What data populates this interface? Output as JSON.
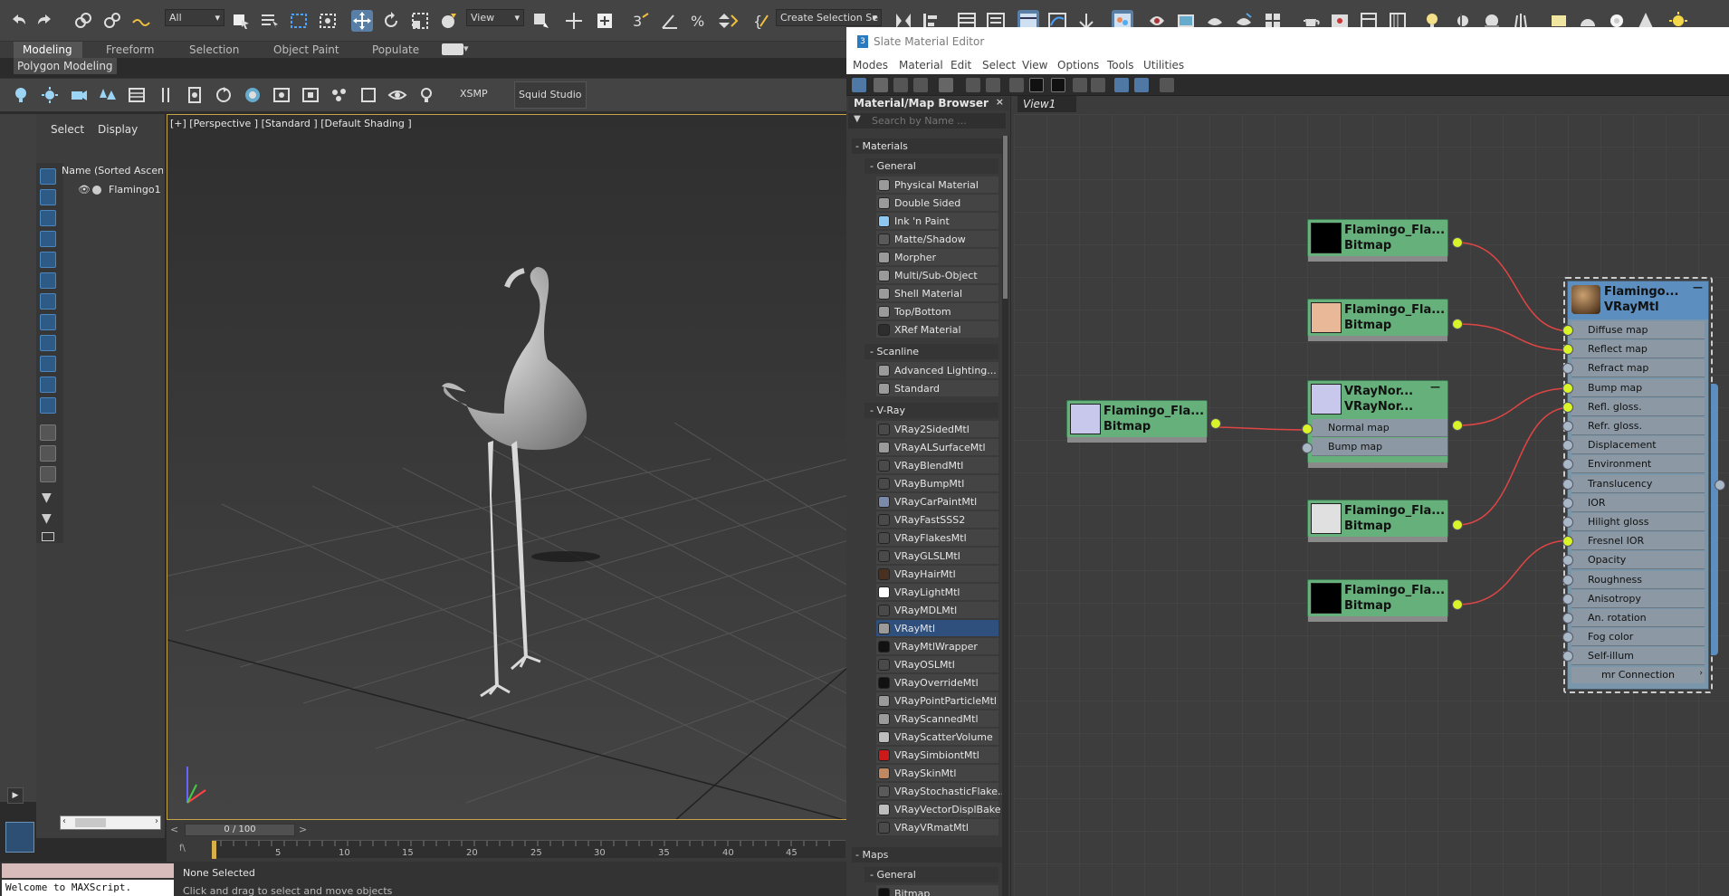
{
  "toolbar": {
    "selection_filter": "All",
    "ref_coord": "View",
    "named_selection": "Create Selection Se"
  },
  "ribbon": {
    "tabs": [
      "Modeling",
      "Freeform",
      "Selection",
      "Object Paint",
      "Populate"
    ],
    "active_panel": "Polygon Modeling",
    "xsmp_label": "XSMP",
    "plugin_label": "Squid Studio v"
  },
  "scene_explorer": {
    "tabs": [
      "Select",
      "Display"
    ],
    "column_header": "Name (Sorted Ascendi",
    "items": [
      "Flamingo1"
    ]
  },
  "viewport": {
    "label": "[+] [Perspective ] [Standard ] [Default Shading ]"
  },
  "timeline": {
    "frame_counter": "0 / 100",
    "ticks": [
      "5",
      "10",
      "15",
      "20",
      "25",
      "30",
      "35",
      "40",
      "45"
    ]
  },
  "status": {
    "maxscript": "Welcome to MAXScript.",
    "selection": "None Selected",
    "prompt": "Click and drag to select and move objects"
  },
  "slate": {
    "title": "Slate Material Editor",
    "menu": [
      "Modes",
      "Material",
      "Edit",
      "Select",
      "View",
      "Options",
      "Tools",
      "Utilities"
    ],
    "view_tab": "View1",
    "browser": {
      "title": "Material/Map Browser",
      "search_placeholder": "Search by Name ...",
      "materials_label": "- Materials",
      "groups": [
        {
          "label": "- General",
          "items": [
            {
              "name": "Physical Material",
              "swatch": "#9a9a9a"
            },
            {
              "name": "Double Sided",
              "swatch": "#9a9a9a"
            },
            {
              "name": "Ink 'n Paint",
              "swatch": "#8ec8f0"
            },
            {
              "name": "Matte/Shadow",
              "swatch": "#5a5a5a"
            },
            {
              "name": "Morpher",
              "swatch": "#9a9a9a"
            },
            {
              "name": "Multi/Sub-Object",
              "swatch": "#9a9a9a"
            },
            {
              "name": "Shell Material",
              "swatch": "#9a9a9a"
            },
            {
              "name": "Top/Bottom",
              "swatch": "#9a9a9a"
            },
            {
              "name": "XRef Material",
              "swatch": "#2e2e2e"
            }
          ]
        },
        {
          "label": "- Scanline",
          "items": [
            {
              "name": "Advanced Lighting...",
              "swatch": "#9a9a9a"
            },
            {
              "name": "Standard",
              "swatch": "#9a9a9a"
            }
          ]
        },
        {
          "label": "- V-Ray",
          "items": [
            {
              "name": "VRay2SidedMtl",
              "swatch": "#4a4a4a"
            },
            {
              "name": "VRayALSurfaceMtl",
              "swatch": "#9a9a9a"
            },
            {
              "name": "VRayBlendMtl",
              "swatch": "#4a4a4a"
            },
            {
              "name": "VRayBumpMtl",
              "swatch": "#4a4a4a"
            },
            {
              "name": "VRayCarPaintMtl",
              "swatch": "#7a8aa8"
            },
            {
              "name": "VRayFastSSS2",
              "swatch": "#4a4a4a"
            },
            {
              "name": "VRayFlakesMtl",
              "swatch": "#4a4a4a"
            },
            {
              "name": "VRayGLSLMtl",
              "swatch": "#4a4a4a"
            },
            {
              "name": "VRayHairMtl",
              "swatch": "#4a3020"
            },
            {
              "name": "VRayLightMtl",
              "swatch": "#ffffff"
            },
            {
              "name": "VRayMDLMtl",
              "swatch": "#4a4a4a"
            },
            {
              "name": "VRayMtl",
              "swatch": "#9a9a9a"
            },
            {
              "name": "VRayMtlWrapper",
              "swatch": "#111111"
            },
            {
              "name": "VRayOSLMtl",
              "swatch": "#4a4a4a"
            },
            {
              "name": "VRayOverrideMtl",
              "swatch": "#111111"
            },
            {
              "name": "VRayPointParticleMtl",
              "swatch": "#9a9a9a"
            },
            {
              "name": "VRayScannedMtl",
              "swatch": "#9a9a9a"
            },
            {
              "name": "VRayScatterVolume",
              "swatch": "#bdbdbd"
            },
            {
              "name": "VRaySimbiontMtl",
              "swatch": "#cc1a1a"
            },
            {
              "name": "VRaySkinMtl",
              "swatch": "#c08860"
            },
            {
              "name": "VRayStochasticFlake...",
              "swatch": "#5a5a5a"
            },
            {
              "name": "VRayVectorDisplBake",
              "swatch": "#bdbdbd"
            },
            {
              "name": "VRayVRmatMtl",
              "swatch": "#4a4a4a"
            }
          ]
        }
      ],
      "selected_item": "VRayMtl",
      "maps_label": "- Maps",
      "maps_group": "- General",
      "maps_first": "Bitmap"
    },
    "nodes": {
      "n1": {
        "title": "Flamingo_Fla...",
        "type": "Bitmap",
        "thumb": "#000000"
      },
      "n2": {
        "title": "Flamingo_Fla...",
        "type": "Bitmap",
        "thumb": "#e8b898"
      },
      "n3": {
        "title": "Flamingo_Fla...",
        "type": "Bitmap",
        "thumb": "#c8c8ec"
      },
      "n4": {
        "title": "VRayNor...",
        "subtitle": "VRayNor...",
        "thumb": "#c8c8ec",
        "slots": [
          "Normal map",
          "Bump map"
        ]
      },
      "n5": {
        "title": "Flamingo_Fla...",
        "type": "Bitmap",
        "thumb": "#e0e0e0"
      },
      "n6": {
        "title": "Flamingo_Fla...",
        "type": "Bitmap",
        "thumb": "#000000"
      },
      "vray": {
        "title": "Flamingo...",
        "type": "VRayMtl",
        "slots": [
          "Diffuse map",
          "Reflect map",
          "Refract map",
          "Bump map",
          "Refl. gloss.",
          "Refr. gloss.",
          "Displacement",
          "Environment",
          "Translucency",
          "IOR",
          "Hilight gloss",
          "Fresnel IOR",
          "Opacity",
          "Roughness",
          "Anisotropy",
          "An. rotation",
          "Fog color",
          "Self-illum"
        ],
        "footer": "mr Connection"
      }
    }
  }
}
